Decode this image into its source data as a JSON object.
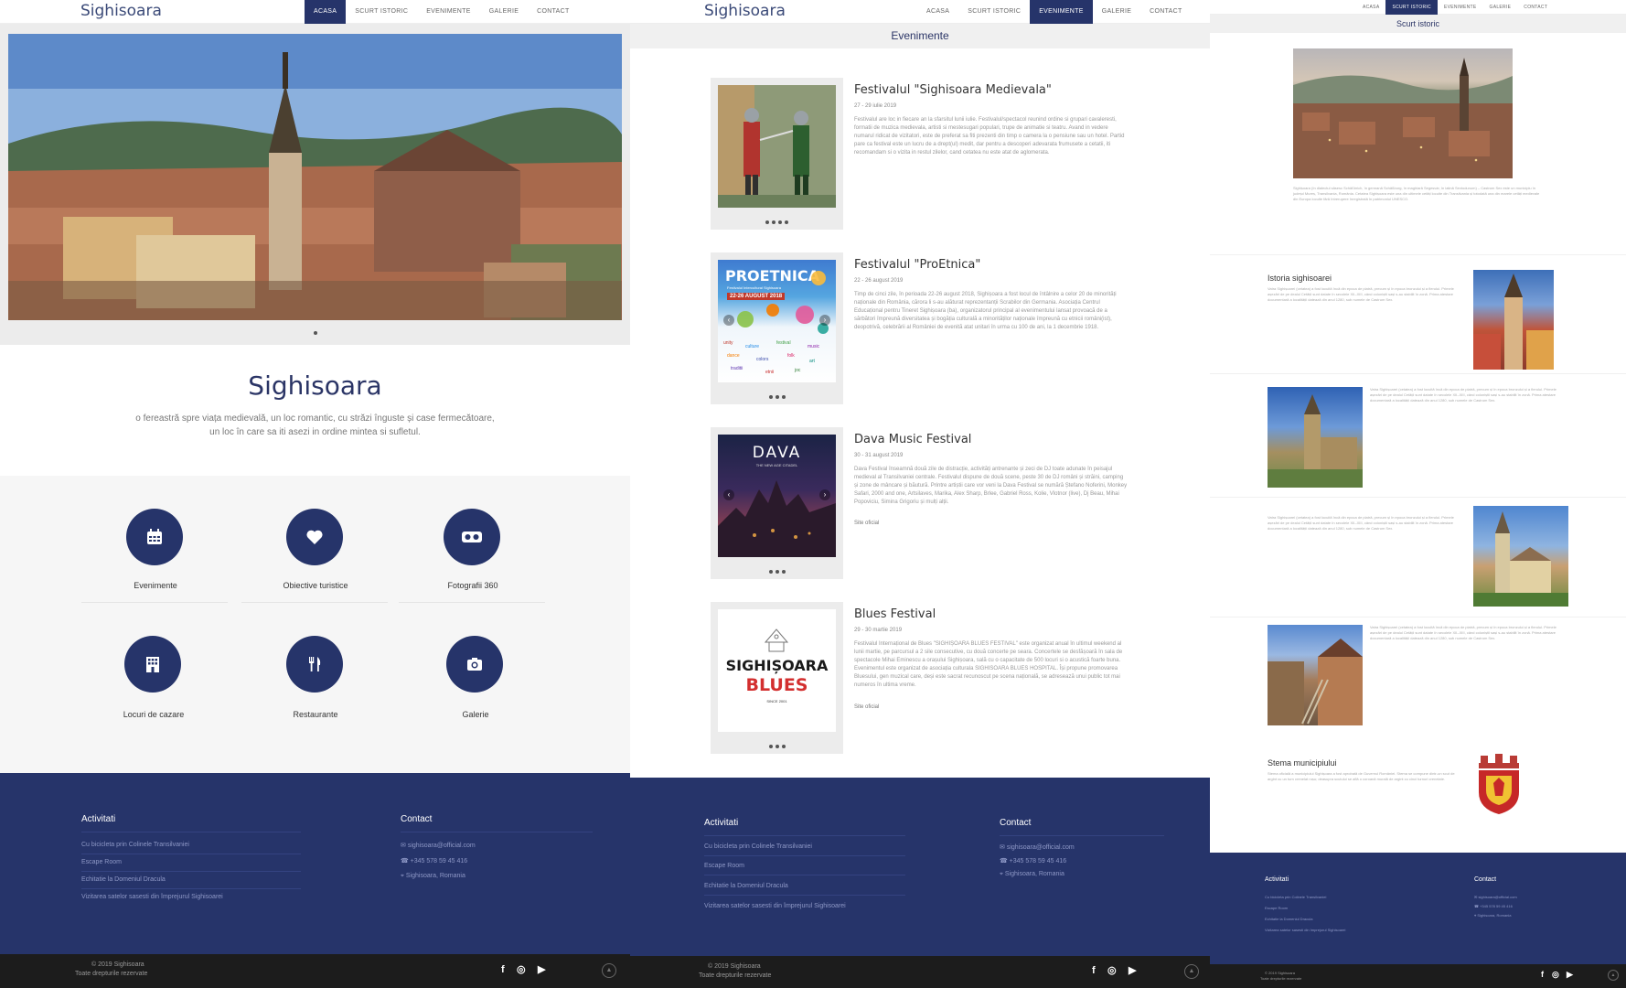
{
  "home": {
    "logo": "Sighisoara",
    "nav": [
      "ACASA",
      "SCURT ISTORIC",
      "EVENIMENTE",
      "GALERIE",
      "CONTACT"
    ],
    "active_tab": "ACASA",
    "title": "Sighisoara",
    "subtitle_line1": "o fereastră spre viața medievală, un loc romantic, cu străzi înguste și case fermecătoare,",
    "subtitle_line2": "un loc în care sa iti asezi in ordine mintea si sufletul.",
    "features": [
      {
        "label": "Evenimente",
        "icon": "calendar-icon"
      },
      {
        "label": "Obiective turistice",
        "icon": "heart-icon"
      },
      {
        "label": "Fotografii 360",
        "icon": "vr-headset-icon"
      },
      {
        "label": "Locuri de cazare",
        "icon": "building-icon"
      },
      {
        "label": "Restaurante",
        "icon": "fork-knife-icon"
      },
      {
        "label": "Galerie",
        "icon": "camera-icon"
      }
    ]
  },
  "events_page": {
    "logo": "Sighisoara",
    "nav": [
      "ACASA",
      "SCURT ISTORIC",
      "EVENIMENTE",
      "GALERIE",
      "CONTACT"
    ],
    "active_tab": "EVENIMENTE",
    "section_title": "Evenimente",
    "events": [
      {
        "title": "Festivalul \"Sighisoara Medievala\"",
        "date": "27 - 29 iulie 2019",
        "text": "Festivalul are loc in fiecare an la sfarsitul lunii iulie. Festivalul/spectacol reunind ordine si grupari cavaleresti, formatii de muzica medievala, artisti si mestesugari populari, trupe de animatie si teatru. Avand in vedere numarul ridicat de vizitatori, este de preferat sa fiti prezenti din timp o camera la o pensiune sau un hotel. Partid pare ca festival este un lucru de a drept(ul) medit, dar pentru a descoperi adevarata frumusete a cetatii, iti recomandam si o vizita in restul zilelor, cand cetatea nu este atat de aglomerata.",
        "dots": 4,
        "link": ""
      },
      {
        "title": "Festivalul \"ProEtnica\"",
        "date": "22 - 26 august 2019",
        "text": "Timp de cinci zile, în perioada 22-26 august 2018, Sighișoara a fost locul de întâlnire a celor 20 de minorități naționale din România, cărora li s-au alăturat reprezentanții Scrabilor din Germania. Asociația Centrul Educațional pentru Tineret Sighișoara (ba), organizatorul principal al evenimentului lansat provoacă de a sărbători împreună diversitatea și bogăția culturală a minorităților naționale împreună cu etnicii români(ist), deopotrivă, celebrării al României de evenită atat unitari în urma cu 100 de ani, la 1 decembrie 1918.",
        "dots": 3,
        "link": "",
        "poster_title": "PROETNICA",
        "poster_sub": "Festivalul Intercultural Sighisoara",
        "poster_dates": "22-26 AUGUST 2018"
      },
      {
        "title": "Dava Music Festival",
        "date": "30 - 31 august 2019",
        "text": "Dava Festival înseamnă două zile de distracție, activități antrenante și zeci de DJ toate adunate în peisajul medieval al Transilvaniei centrale. Festivalul dispune de două scene, peste 30 de DJ români și străini, camping și zone de mâncare și băutură. Printre artiștii care vor veni la Dava Festival se numără Ștefano Noferini, Monkey Safari, 2000 and one, Artsilaves, Marika, Alex Sharp, Brlee, Gabriel Ross, Kolie, Vlotnor (live), Dj Beau, Mihai Popoviciu, Simina Grigoriu și mulți alții.",
        "dots": 3,
        "link": "Site oficial",
        "poster_title": "DAVA",
        "poster_sub": "THE NEW AGE CITADEL"
      },
      {
        "title": "Blues Festival",
        "date": "29 - 30 martie 2019",
        "text": "Festivalul Internațional de Blues \"SIGHIȘOARA BLUES FESTIVAL\" este organizat anual în ultimul weekend al lunii martie, pe parcursul a 2 sile consecutive, cu două concerte pe seara. Concertele se desfășoară în sala de spectacole Mihai Eminescu a orașului Sighișoara, sală cu o capacitate de 500 locuri si o acustică foarte buna. Evenimentul este organizat de asociația culturala SIGHISOARA BLUES HOSPITAL. Își propune promovarea Bluesului, gen muzical care, deși este sacrat recunoscut pe scena națională, se adresează unui public tot mai numeros în ultima vreme.",
        "dots": 3,
        "link": "Site oficial",
        "poster_title": "SIGHIȘOARA",
        "poster_sub": "BLUES",
        "poster_since": "SINCE 2001"
      }
    ]
  },
  "history_page": {
    "nav": [
      "ACASA",
      "SCURT ISTORIC",
      "EVENIMENTE",
      "GALERIE",
      "CONTACT"
    ],
    "active_tab": "SCURT ISTORIC",
    "section_title": "Scurt istoric",
    "intro": "Sighișoara (în dialectul săsesc Schäßbrich, în germană Schäßburg, în maghiară Segesvár, în latină Sextodunum) – Castrum Sex este un municipiu în județul Mureș, Transilvania, România. Cetatea Sighișoara este una din ultimele cetăți locuite din Transilvania și totodată una din marele cetăți medievale din Europa locuite fără întrerupere înregistrată în patrimoniul UNESCO.",
    "history_title": "Istoria sighisoarei",
    "history_text": "Vatra Sighișoarei (cetatea) a fost locuită încă din epoca de piatră, precum și în epoca bronzului și a fierului. Primele așezări de pe dealul Cetății sunt datate în secolele XII–XIII, când coloniștii sași s-au stabilit în zonă. Prima atestare documentară a localității datează din anul 1280, sub numele de Castrum Sex.",
    "coat_title": "Stema municipiului",
    "coat_text": "Stema oficială a municipiului Sighișoara a fost aprobată de Guvernul României. Stema se compune dintr-un scut de argint cu un turn crenelat roșu; deasupra scutului se află o coroană murală de argint cu cinci turnuri crenelate."
  },
  "footer": {
    "activities_title": "Activitati",
    "activities": [
      "Cu bicicleta prin Colinele Transilvaniei",
      "Escape Room",
      "Echitatie la Domeniul Dracula",
      "Vizitarea satelor sasesti din împrejurul Sighisoarei"
    ],
    "contact_title": "Contact",
    "email": "sighisoara@official.com",
    "phone": "+345 578 59 45 416",
    "location": "Sighisoara, Romania",
    "copyright": "© 2019 Sighisoara",
    "rights": "Toate drepturile rezervate"
  },
  "colors": {
    "primary": "#26346a",
    "footer_bottom": "#1c1c1c",
    "section_bg": "#f6f6f6"
  }
}
